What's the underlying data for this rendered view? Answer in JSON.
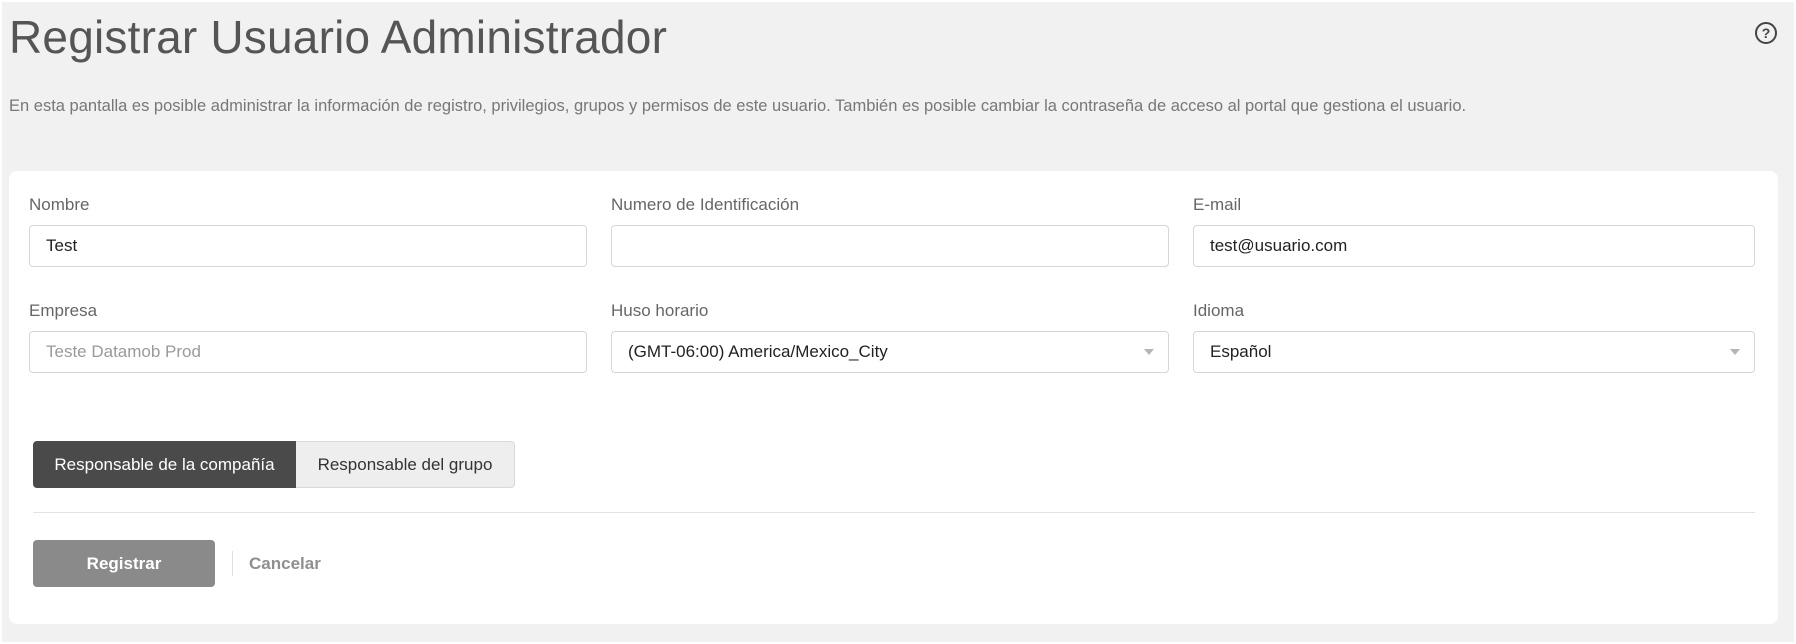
{
  "header": {
    "title": "Registrar Usuario Administrador",
    "help_icon": "question-circle-icon",
    "description": "En esta pantalla es posible administrar la información de registro, privilegios, grupos y permisos de este usuario. También es posible cambiar la contraseña de acceso al portal que gestiona el usuario."
  },
  "form": {
    "nombre": {
      "label": "Nombre",
      "value": "Test"
    },
    "numero_identificacion": {
      "label": "Numero de Identificación",
      "value": ""
    },
    "email": {
      "label": "E-mail",
      "value": "test@usuario.com"
    },
    "empresa": {
      "label": "Empresa",
      "value": "Teste Datamob Prod"
    },
    "huso_horario": {
      "label": "Huso horario",
      "value": "(GMT-06:00) America/Mexico_City"
    },
    "idioma": {
      "label": "Idioma",
      "value": "Español"
    }
  },
  "role_toggle": {
    "options": [
      "Responsable de la compañía",
      "Responsable del grupo"
    ],
    "selected": "Responsable de la compañía"
  },
  "actions": {
    "register_label": "Registrar",
    "cancel_label": "Cancelar"
  },
  "colors": {
    "page_bg": "#f1f1f1",
    "card_bg": "#ffffff",
    "toggle_active_bg": "#4a4a4a",
    "register_button_bg": "#8a8a8a"
  }
}
